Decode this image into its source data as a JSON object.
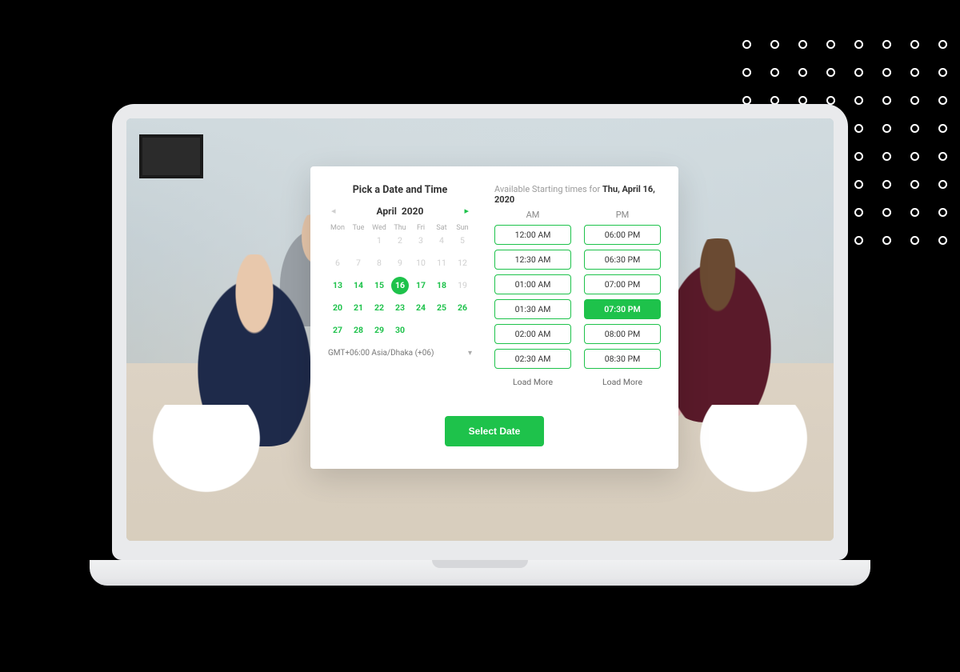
{
  "widget": {
    "title": "Pick a Date and Time",
    "available_prefix": "Available Starting times for ",
    "available_date_bold": "Thu, April 16, 2020",
    "timezone": "GMT+06:00 Asia/Dhaka (+06)",
    "select_button": "Select Date"
  },
  "calendar": {
    "month": "April",
    "year": "2020",
    "weekdays": [
      "Mon",
      "Tue",
      "Wed",
      "Thu",
      "Fri",
      "Sat",
      "Sun"
    ],
    "selected_day": 16,
    "rows": [
      [
        null,
        null,
        1,
        2,
        3,
        4,
        5
      ],
      [
        6,
        7,
        8,
        9,
        10,
        11,
        12
      ],
      [
        13,
        14,
        15,
        16,
        17,
        18,
        19
      ],
      [
        20,
        21,
        22,
        23,
        24,
        25,
        26
      ],
      [
        27,
        28,
        29,
        30,
        null,
        null,
        null
      ]
    ],
    "past_cutoff": 12,
    "unavailable_after_selected": [
      19
    ]
  },
  "times": {
    "am_label": "AM",
    "pm_label": "PM",
    "am": [
      "12:00 AM",
      "12:30 AM",
      "01:00 AM",
      "01:30 AM",
      "02:00 AM",
      "02:30 AM"
    ],
    "pm": [
      "06:00 PM",
      "06:30 PM",
      "07:00 PM",
      "07:30 PM",
      "08:00 PM",
      "08:30 PM"
    ],
    "selected_pm_index": 3,
    "load_more": "Load More"
  },
  "colors": {
    "accent": "#1ec24b"
  }
}
